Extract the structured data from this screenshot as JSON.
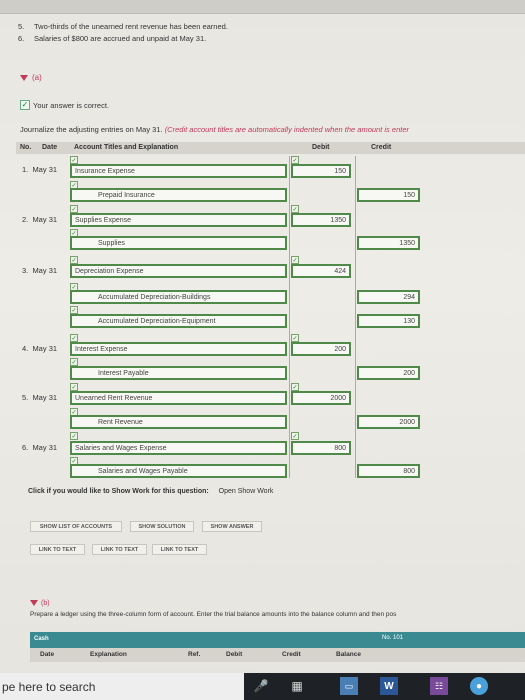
{
  "requirements": [
    {
      "num": "5.",
      "text": "Two-thirds of the unearned rent revenue has been earned."
    },
    {
      "num": "6.",
      "text": "Salaries of $800 are accrued and unpaid at May 31."
    }
  ],
  "part_a": {
    "label": "(a)",
    "correct_text": "Your answer is correct.",
    "instruction": "Journalize the adjusting entries on May 31.",
    "instruction_hint": "(Credit account titles are automatically indented when the amount is enter"
  },
  "table_header": {
    "no": "No.",
    "date": "Date",
    "titles": "Account Titles and Explanation",
    "debit": "Debit",
    "credit": "Credit"
  },
  "entries": [
    {
      "no": "1.",
      "date": "May 31",
      "debit_account": "Insurance Expense",
      "debit": "150",
      "credit_account": "Prepaid Insurance",
      "credit": "150"
    },
    {
      "no": "2.",
      "date": "May 31",
      "debit_account": "Supplies Expense",
      "debit": "1350",
      "credit_account": "Supplies",
      "credit": "1350"
    },
    {
      "no": "3.",
      "date": "May 31",
      "debit_account": "Depreciation Expense",
      "debit": "424",
      "credit_account": "Accumulated Depreciation-Buildings",
      "credit": "294",
      "credit_account_2": "Accumulated Depreciation-Equipment",
      "credit_2": "130"
    },
    {
      "no": "4.",
      "date": "May 31",
      "debit_account": "Interest Expense",
      "debit": "200",
      "credit_account": "Interest Payable",
      "credit": "200"
    },
    {
      "no": "5.",
      "date": "May 31",
      "debit_account": "Unearned Rent Revenue",
      "debit": "2000",
      "credit_account": "Rent Revenue",
      "credit": "2000"
    },
    {
      "no": "6.",
      "date": "May 31",
      "debit_account": "Salaries and Wages Expense",
      "debit": "800",
      "credit_account": "Salaries and Wages Payable",
      "credit": "800"
    }
  ],
  "show_work": {
    "prompt": "Click if you would like to Show Work for this question:",
    "link": "Open Show Work"
  },
  "buttons": {
    "show_accounts": "SHOW LIST OF ACCOUNTS",
    "show_solution": "SHOW SOLUTION",
    "show_answer": "SHOW ANSWER",
    "link1": "LINK TO TEXT",
    "link2": "LINK TO TEXT",
    "link3": "LINK TO TEXT"
  },
  "part_b": {
    "label": "(b)",
    "instruction": "Prepare a ledger using the three-column form of account. Enter the trial balance amounts into the balance column and then pos",
    "account": "Cash",
    "account_no": "No. 101",
    "cols": {
      "date": "Date",
      "explanation": "Explanation",
      "ref": "Ref.",
      "debit": "Debit",
      "credit": "Credit",
      "balance": "Balance"
    }
  },
  "taskbar": {
    "search_text": "pe here to search"
  },
  "colors": {
    "accent": "#4f8a4a",
    "header_teal": "#3a8a92",
    "hint_red": "#c23a5a"
  }
}
